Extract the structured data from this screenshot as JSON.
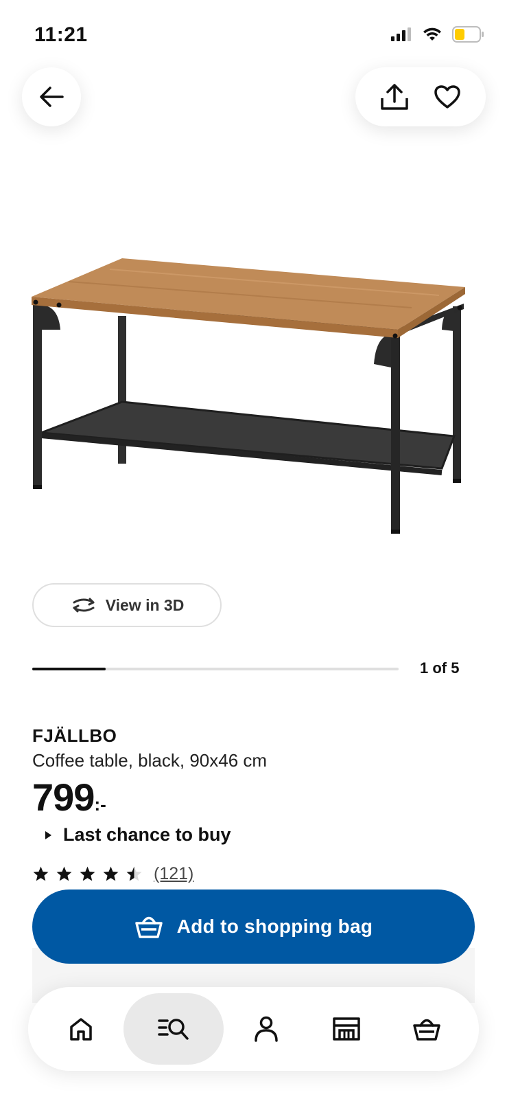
{
  "status_bar": {
    "time": "11:21"
  },
  "header": {
    "back_icon": "arrow-left-icon",
    "share_icon": "share-icon",
    "favorite_icon": "heart-icon"
  },
  "product_image": {
    "alt": "FJÄLLBO coffee table"
  },
  "view3d": {
    "label": "View in 3D",
    "icon": "rotate-3d-icon"
  },
  "gallery": {
    "counter": "1 of 5",
    "current": 1,
    "total": 5
  },
  "product": {
    "name": "FJÄLLBO",
    "description": "Coffee table, black, 90x46 cm",
    "price": "799",
    "price_suffix": ":-",
    "availability": "Last chance to buy",
    "rating_value": 4.5,
    "rating_count": "(121)"
  },
  "cta": {
    "label": "Add to shopping bag",
    "icon": "shopping-basket-icon"
  },
  "bottom_nav": {
    "items": [
      {
        "name": "home",
        "icon": "home-icon",
        "active": false
      },
      {
        "name": "search",
        "icon": "search-list-icon",
        "active": true
      },
      {
        "name": "profile",
        "icon": "person-icon",
        "active": false
      },
      {
        "name": "store",
        "icon": "store-icon",
        "active": false
      },
      {
        "name": "bag",
        "icon": "shopping-basket-icon",
        "active": false
      }
    ]
  },
  "colors": {
    "primary": "#0058a3",
    "wood": "#b98553",
    "metal": "#2b2b2b"
  }
}
